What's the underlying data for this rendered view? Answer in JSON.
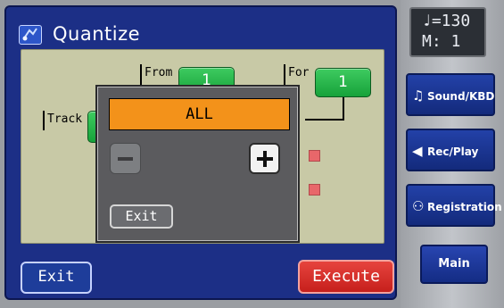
{
  "window": {
    "title": "Quantize"
  },
  "panel": {
    "track_label": "Track",
    "from_label": "From",
    "from_value": "1",
    "for_label": "For",
    "for_value": "1"
  },
  "popup": {
    "value": "ALL",
    "exit_label": "Exit",
    "minus_icon": "minus-icon",
    "plus_icon": "plus-icon"
  },
  "bottom": {
    "exit_label": "Exit",
    "execute_label": "Execute"
  },
  "sidebar": {
    "tempo_line": "♩=130",
    "measure_line": "M:   1",
    "buttons": [
      {
        "icon": "♫",
        "label": "Sound/KBD"
      },
      {
        "icon": "◀",
        "label": "Rec/Play"
      },
      {
        "icon": "⚇",
        "label": "Registration"
      }
    ],
    "main_label": "Main"
  },
  "colors": {
    "window_bg": "#1c2f86",
    "panel_bg": "#c8c9a6",
    "value_bar": "#f3921a",
    "green_button": "#17a23a",
    "execute_red": "#c61f1c"
  }
}
